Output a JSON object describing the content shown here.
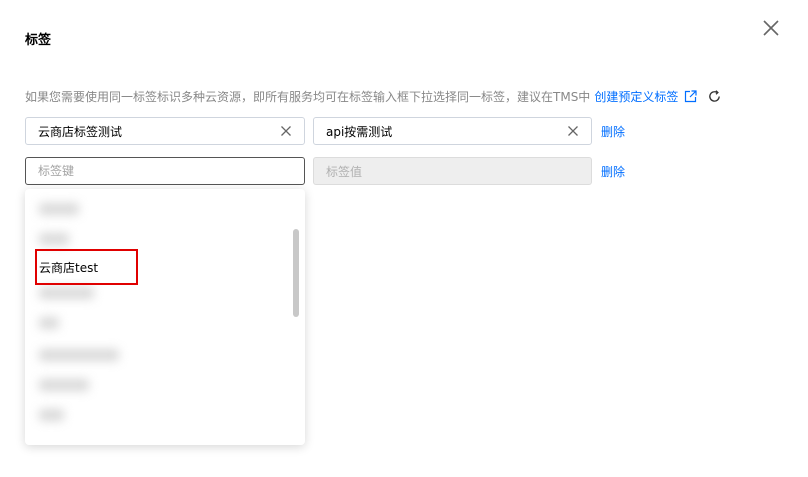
{
  "dialog": {
    "title": "标签",
    "close_icon": "close-icon"
  },
  "hint": {
    "text": "如果您需要使用同一标签标识多种云资源，即所有服务均可在标签输入框下拉选择同一标签，建议在TMS中",
    "link": "创建预定义标签"
  },
  "rows": [
    {
      "key": "云商店标签测试",
      "value": "api按需测试",
      "delete": "删除"
    },
    {
      "key_placeholder": "标签键",
      "value_placeholder": "标签值",
      "delete": "删除"
    }
  ],
  "dropdown": {
    "visible_option": "云商店test"
  },
  "colors": {
    "accent": "#006eff",
    "highlight": "#e00000"
  }
}
